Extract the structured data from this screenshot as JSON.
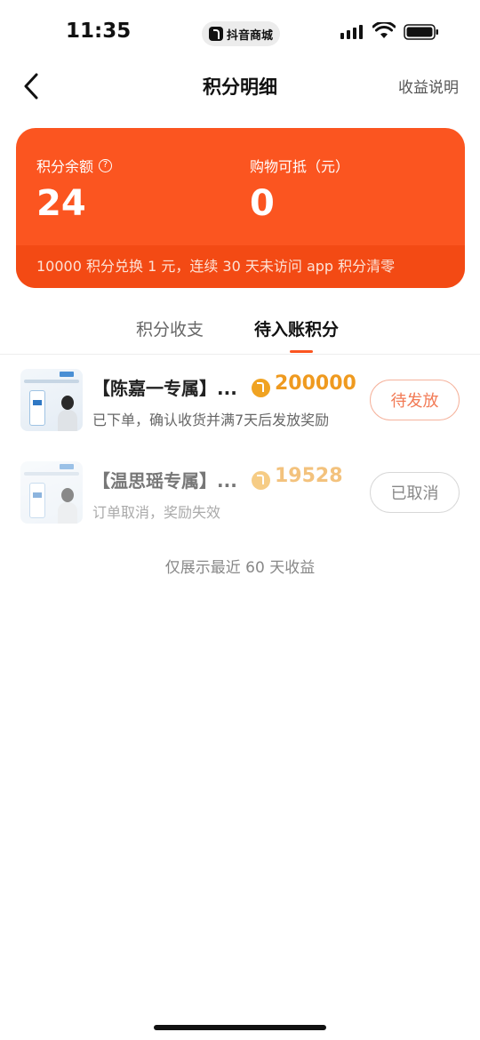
{
  "status_bar": {
    "time": "11:35",
    "app_pill_label": "抖音商城",
    "icons": [
      "signal-icon",
      "wifi-icon",
      "battery-icon"
    ]
  },
  "nav": {
    "back_icon": "chevron-left-icon",
    "title": "积分明细",
    "action_label": "收益说明"
  },
  "card": {
    "balance_label": "积分余额",
    "balance_value": "24",
    "deduct_label": "购物可抵（元）",
    "deduct_value": "0",
    "footer_text": "10000 积分兑换 1 元，连续 30 天未访问 app 积分清零",
    "color": "#fb5520"
  },
  "tabs": [
    {
      "label": "积分收支",
      "active": false
    },
    {
      "label": "待入账积分",
      "active": true
    }
  ],
  "items": [
    {
      "title": "【陈嘉一专属】...",
      "points": "200000",
      "description": "已下单，确认收货并满7天后发放奖励",
      "status": "待发放"
    },
    {
      "title": "【温思瑶专属】...",
      "points": "19528",
      "description": "订单取消，奖励失效",
      "status": "已取消"
    }
  ],
  "footer_note": "仅展示最近 60 天收益",
  "colors": {
    "accent": "#fb5520",
    "points": "#ef9a1f"
  }
}
